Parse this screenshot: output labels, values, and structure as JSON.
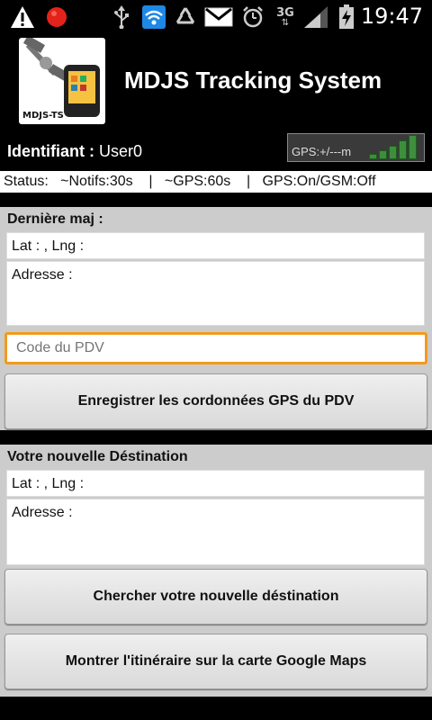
{
  "status_bar": {
    "icons": [
      "warning-icon",
      "record-icon",
      "usb-icon",
      "wifi-icon",
      "recycle-icon",
      "gmail-icon",
      "alarm-icon",
      "3g-icon",
      "signal-icon",
      "battery-charging-icon"
    ],
    "network_label": "3G",
    "time": "19:47"
  },
  "header": {
    "logo_text": "MDJS-TS",
    "title": "MDJS Tracking System"
  },
  "user": {
    "label": "Identifiant :",
    "value": "User0",
    "gps_indicator": "GPS:+/---m"
  },
  "status_strip": "Status:   ~Notifs:30s    |   ~GPS:60s    |   GPS:On/GSM:Off",
  "last_update": {
    "title": "Dernière maj :",
    "latlng": "Lat : , Lng :",
    "address": "Adresse :",
    "pdv_placeholder": "Code du PDV",
    "save_button": "Enregistrer les cordonnées GPS du PDV"
  },
  "destination": {
    "title": "Votre nouvelle Déstination",
    "latlng": "Lat : , Lng :",
    "address": "Adresse :",
    "search_button": "Chercher votre nouvelle déstination",
    "map_button": "Montrer l'itinéraire sur la carte Google Maps"
  },
  "colors": {
    "accent_focus": "#f39a1e",
    "panel_bg": "#cccccc",
    "signal_green": "#3d8f3d"
  }
}
